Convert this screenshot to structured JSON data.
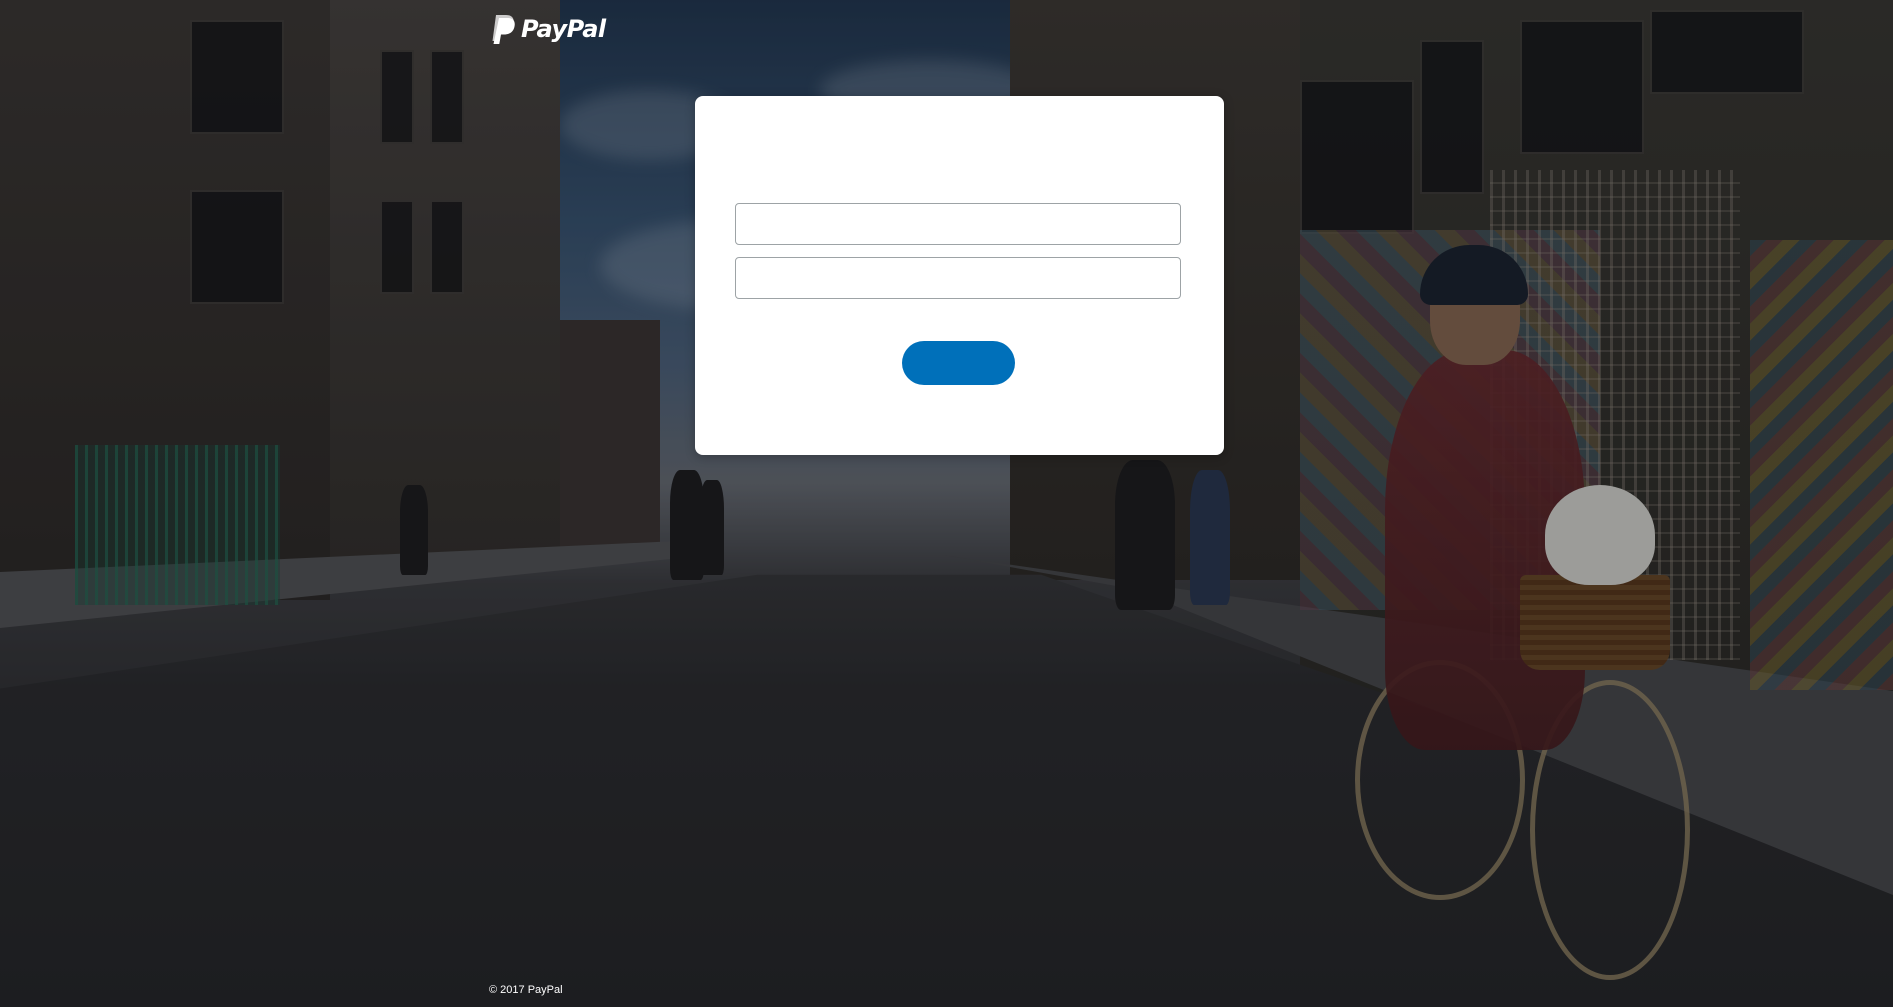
{
  "header": {
    "logo_text": "PayPal",
    "logo_icon": "paypal-p-icon"
  },
  "login_card": {
    "email_field": {
      "value": "",
      "placeholder": ""
    },
    "password_field": {
      "value": "",
      "placeholder": ""
    },
    "login_button_label": ""
  },
  "footer": {
    "copyright": "© 2017 PayPal"
  },
  "colors": {
    "button_blue": "#0070ba",
    "card_background": "#ffffff",
    "field_border": "#9da3a6",
    "text_white": "#ffffff"
  }
}
